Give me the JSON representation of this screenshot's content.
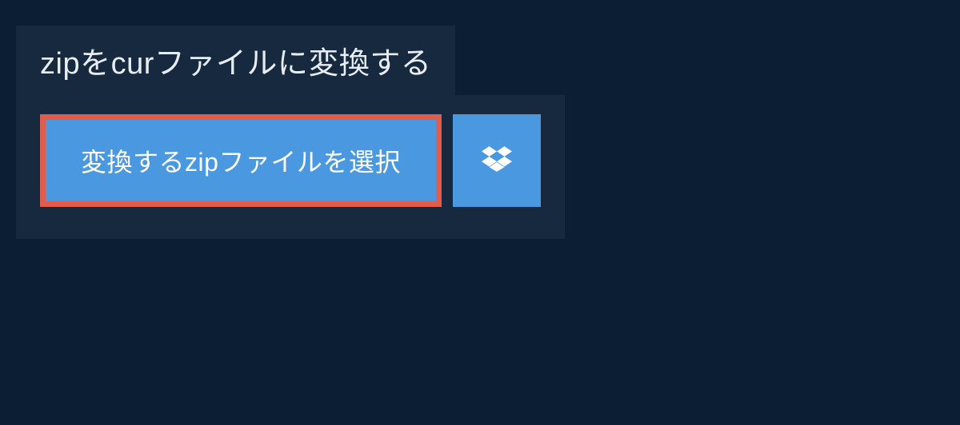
{
  "heading": "zipをcurファイルに変換する",
  "buttons": {
    "select_label": "変換するzipファイルを選択"
  }
}
